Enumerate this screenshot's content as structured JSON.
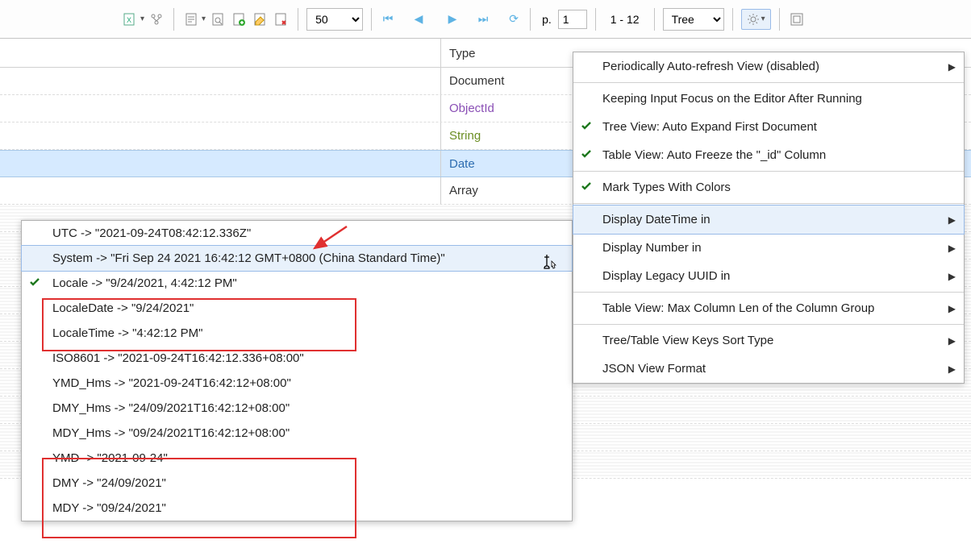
{
  "toolbar": {
    "page_size_options": [
      "50"
    ],
    "page_size_value": "50",
    "page_label": "p.",
    "page_value": "1",
    "range": "1 - 12",
    "view_mode_value": "Tree"
  },
  "grid": {
    "type_header": "Type",
    "rows": [
      {
        "type": "Document",
        "type_class": "document"
      },
      {
        "type": "ObjectId",
        "type_class": "objectid"
      },
      {
        "type": "String",
        "type_class": "string"
      },
      {
        "type": "Date",
        "type_class": "date",
        "selected": true
      },
      {
        "type": "Array",
        "type_class": "array"
      }
    ]
  },
  "settings_menu": [
    {
      "label": "Periodically Auto-refresh View (disabled)",
      "arrow": true
    },
    {
      "sep": true
    },
    {
      "label": "Keeping Input Focus on the Editor After Running"
    },
    {
      "label": "Tree View: Auto Expand First Document",
      "checked": true
    },
    {
      "label": "Table View: Auto Freeze the \"_id\" Column",
      "checked": true
    },
    {
      "sep": true
    },
    {
      "label": "Mark Types With Colors",
      "checked": true
    },
    {
      "sep": true
    },
    {
      "label": "Display DateTime in",
      "arrow": true,
      "hover": true
    },
    {
      "label": "Display Number in",
      "arrow": true
    },
    {
      "label": "Display Legacy UUID in",
      "arrow": true
    },
    {
      "sep": true
    },
    {
      "label": "Table View: Max Column Len of the Column Group",
      "arrow": true
    },
    {
      "sep": true
    },
    {
      "label": "Tree/Table View Keys Sort Type",
      "arrow": true
    },
    {
      "label": "JSON View Format",
      "arrow": true
    }
  ],
  "datetime_menu": [
    {
      "label": "UTC -> \"2021-09-24T08:42:12.336Z\""
    },
    {
      "label": "System -> \"Fri Sep 24 2021 16:42:12 GMT+0800 (China Standard Time)\"",
      "hover": true
    },
    {
      "label": "Locale -> \"9/24/2021, 4:42:12 PM\"",
      "checked": true
    },
    {
      "label": "LocaleDate -> \"9/24/2021\""
    },
    {
      "label": "LocaleTime -> \"4:42:12 PM\""
    },
    {
      "label": "ISO8601 -> \"2021-09-24T16:42:12.336+08:00\""
    },
    {
      "label": "YMD_Hms -> \"2021-09-24T16:42:12+08:00\""
    },
    {
      "label": "DMY_Hms -> \"24/09/2021T16:42:12+08:00\""
    },
    {
      "label": "MDY_Hms -> \"09/24/2021T16:42:12+08:00\""
    },
    {
      "label": "YMD -> \"2021-09-24\""
    },
    {
      "label": "DMY -> \"24/09/2021\""
    },
    {
      "label": "MDY -> \"09/24/2021\""
    }
  ]
}
